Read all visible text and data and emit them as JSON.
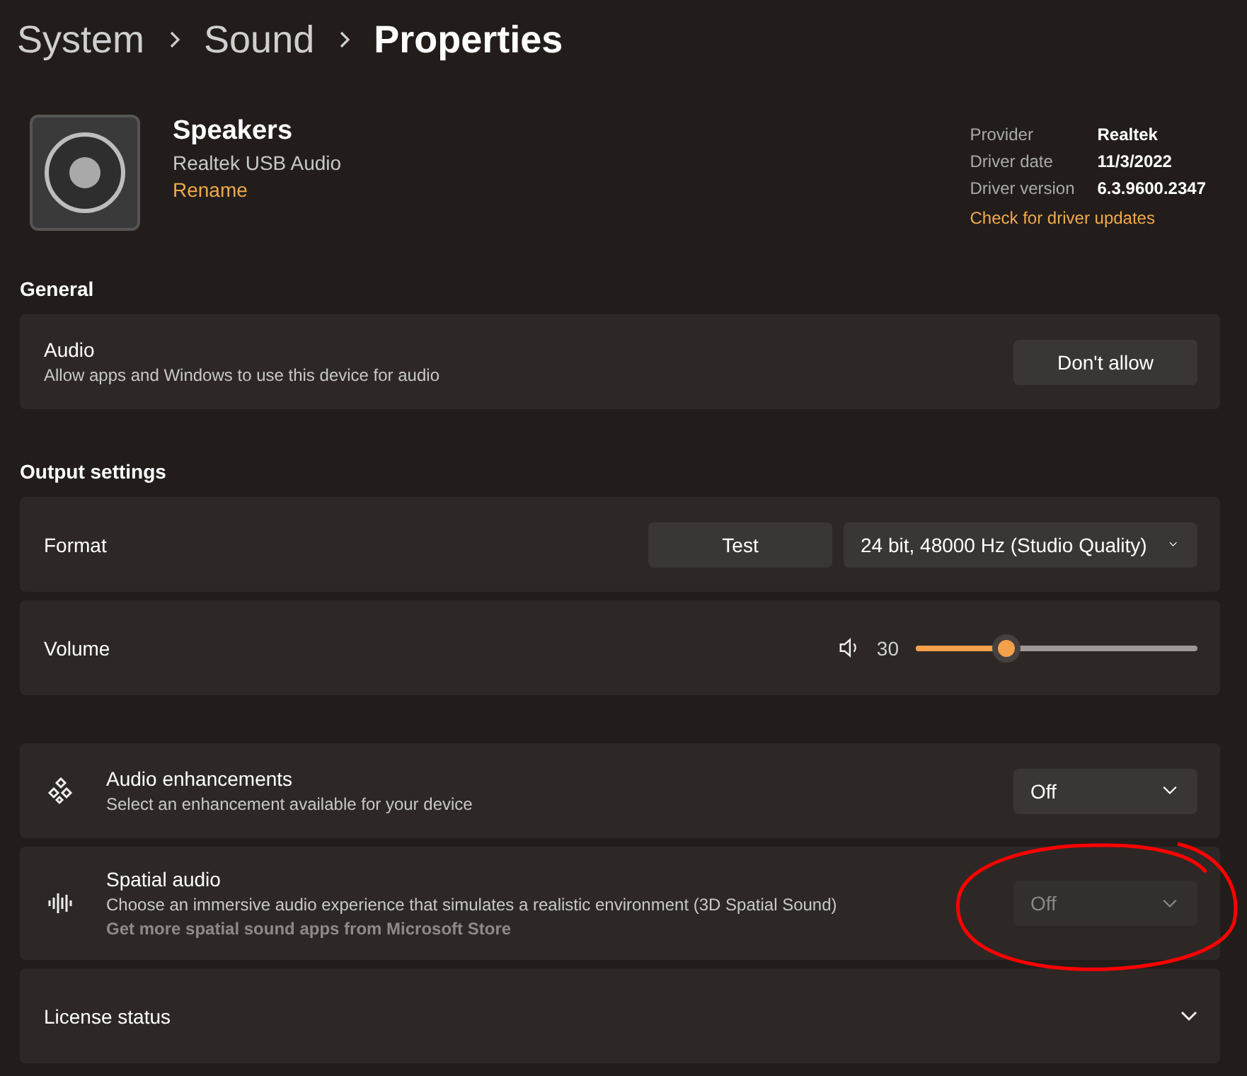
{
  "breadcrumb": [
    {
      "label": "System",
      "selected": false
    },
    {
      "label": "Sound",
      "selected": false
    },
    {
      "label": "Properties",
      "selected": true
    }
  ],
  "device": {
    "name": "Speakers",
    "subtitle": "Realtek USB Audio",
    "rename": "Rename"
  },
  "driver": {
    "info": [
      {
        "label": "Provider",
        "value": "Realtek"
      },
      {
        "label": "Driver date",
        "value": "11/3/2022"
      },
      {
        "label": "Driver version",
        "value": "6.3.9600.2347"
      }
    ],
    "link": "Check for driver updates"
  },
  "sections": [
    {
      "heading": "General",
      "rows": [
        {
          "kind": "button",
          "title": "Audio",
          "description": "Allow apps and Windows to use this device for audio",
          "button": "Don't allow"
        }
      ]
    },
    {
      "heading": "Output settings",
      "rows": [
        {
          "kind": "format",
          "title": "Format",
          "button": "Test",
          "dropdown": {
            "value": "24 bit, 48000 Hz (Studio Quality)",
            "disabled": false
          }
        },
        {
          "kind": "slider",
          "title": "Volume",
          "reading": "30",
          "level": 0.32
        }
      ]
    },
    {
      "rows": [
        {
          "kind": "dropdown",
          "title": "Audio enhancements",
          "description": "Select an enhancement available for your device",
          "dropdown": {
            "value": "Off",
            "disabled": false
          }
        },
        {
          "kind": "dropdown",
          "title": "Spatial audio",
          "description": "Choose an immersive audio experience that simulates a realistic environment (3D Spatial Sound)",
          "link": "Get more spatial sound apps from Microsoft Store",
          "dropdown": {
            "value": "Off",
            "disabled": true
          }
        },
        {
          "kind": "expander",
          "title": "License status",
          "expanded": false
        }
      ]
    }
  ]
}
